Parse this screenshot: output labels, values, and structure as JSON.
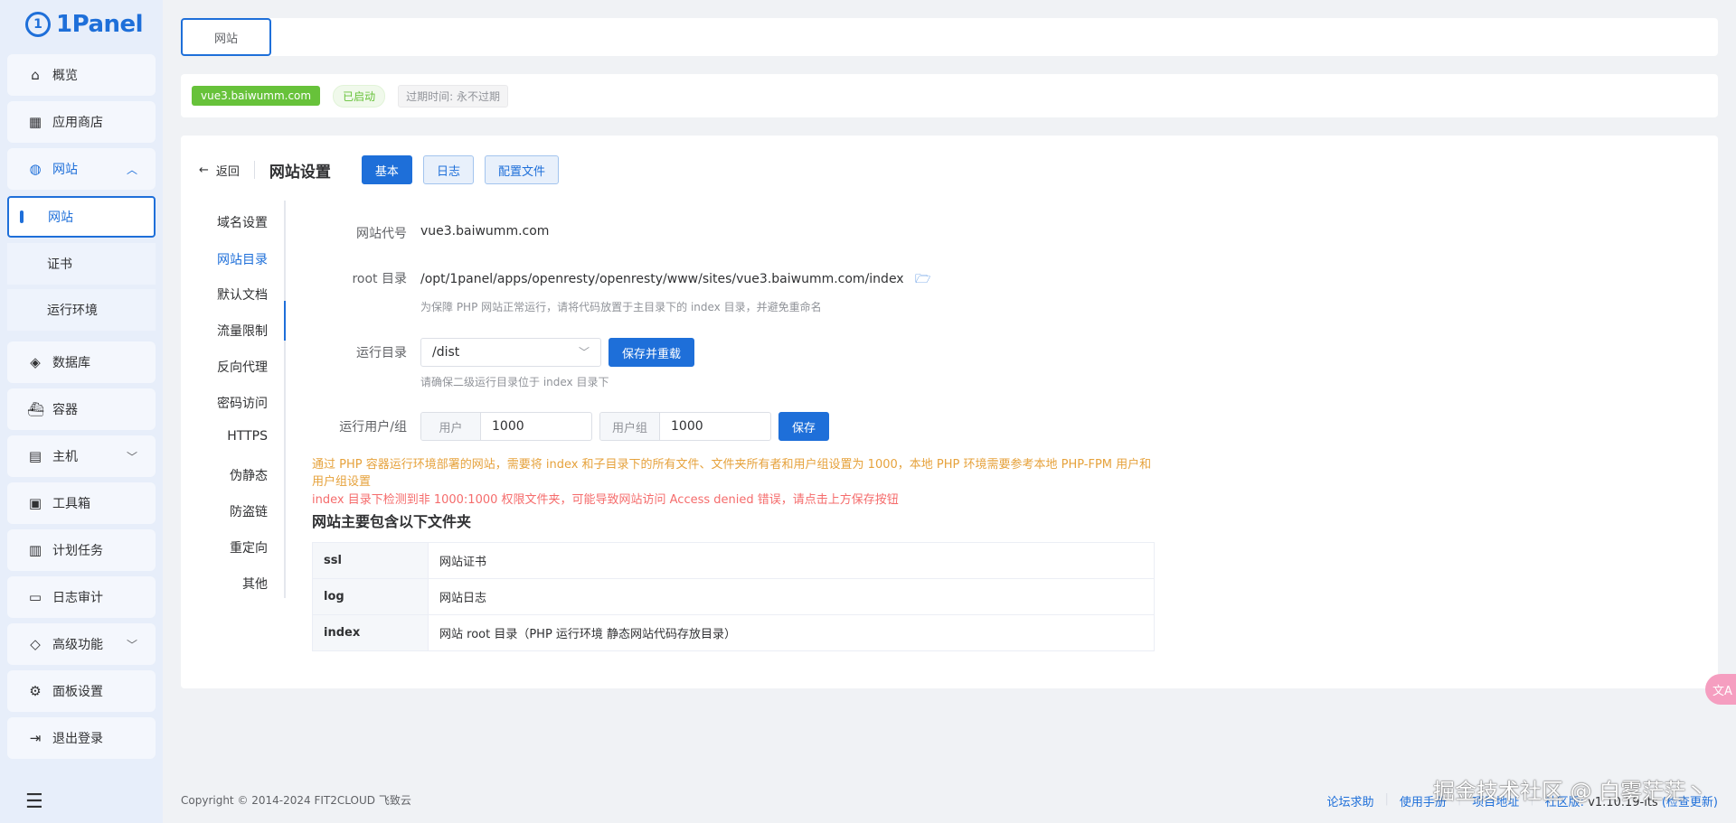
{
  "app": {
    "logo_text": "1Panel",
    "logo_mark": "1"
  },
  "sidebar": {
    "items": [
      {
        "label": "概览",
        "icon": "home-icon"
      },
      {
        "label": "应用商店",
        "icon": "grid-icon"
      },
      {
        "label": "网站",
        "icon": "globe-icon"
      },
      {
        "label": "数据库",
        "icon": "layers-icon"
      },
      {
        "label": "容器",
        "icon": "docker-icon"
      },
      {
        "label": "主机",
        "icon": "server-icon"
      },
      {
        "label": "工具箱",
        "icon": "toolbox-icon"
      },
      {
        "label": "计划任务",
        "icon": "calendar-icon"
      },
      {
        "label": "日志审计",
        "icon": "log-icon"
      },
      {
        "label": "高级功能",
        "icon": "diamond-icon"
      },
      {
        "label": "面板设置",
        "icon": "gear-icon"
      },
      {
        "label": "退出登录",
        "icon": "logout-icon"
      }
    ],
    "sub_items": [
      "网站",
      "证书",
      "运行环境"
    ]
  },
  "tabs": {
    "active": "网站"
  },
  "site": {
    "domain": "vue3.baiwumm.com",
    "status": "已启动",
    "expire": "过期时间: 永不过期"
  },
  "header": {
    "back": "返回",
    "title": "网站设置",
    "buttons": [
      "基本",
      "日志",
      "配置文件"
    ]
  },
  "subnav": [
    "域名设置",
    "网站目录",
    "默认文档",
    "流量限制",
    "反向代理",
    "密码访问",
    "HTTPS",
    "伪静态",
    "防盗链",
    "重定向",
    "其他"
  ],
  "form": {
    "code_label": "网站代号",
    "code_value": "vue3.baiwumm.com",
    "root_label": "root 目录",
    "root_value": "/opt/1panel/apps/openresty/openresty/www/sites/vue3.baiwumm.com/index",
    "root_hint": "为保障 PHP 网站正常运行，请将代码放置于主目录下的 index 目录，并避免重命名",
    "run_label": "运行目录",
    "run_value": "/dist",
    "run_button": "保存并重载",
    "run_hint": "请确保二级运行目录位于 index 目录下",
    "user_label": "运行用户/组",
    "user_prefix": "用户",
    "user_value": "1000",
    "group_prefix": "用户组",
    "group_value": "1000",
    "save_button": "保存"
  },
  "warnings": {
    "orange": "通过 PHP 容器运行环境部署的网站，需要将 index 和子目录下的所有文件、文件夹所有者和用户组设置为 1000，本地 PHP 环境需要参考本地 PHP-FPM 用户和用户组设置",
    "red": "index 目录下检测到非 1000:1000 权限文件夹，可能导致网站访问 Access denied 错误，请点击上方保存按钮"
  },
  "folders": {
    "title": "网站主要包含以下文件夹",
    "rows": [
      {
        "name": "ssl",
        "desc": "网站证书"
      },
      {
        "name": "log",
        "desc": "网站日志"
      },
      {
        "name": "index",
        "desc": "网站 root 目录（PHP 运行环境 静态网站代码存放目录）"
      }
    ]
  },
  "footer": {
    "copyright": "Copyright © 2014-2024 FIT2CLOUD 飞致云",
    "links": [
      "论坛求助",
      "使用手册",
      "项目地址"
    ],
    "edition": "社区版:",
    "version": "v1.10.19-lts",
    "check_update": "(检查更新)"
  },
  "watermark": "掘金技术社区 @ 白雾茫茫丶",
  "float_button": "文A"
}
